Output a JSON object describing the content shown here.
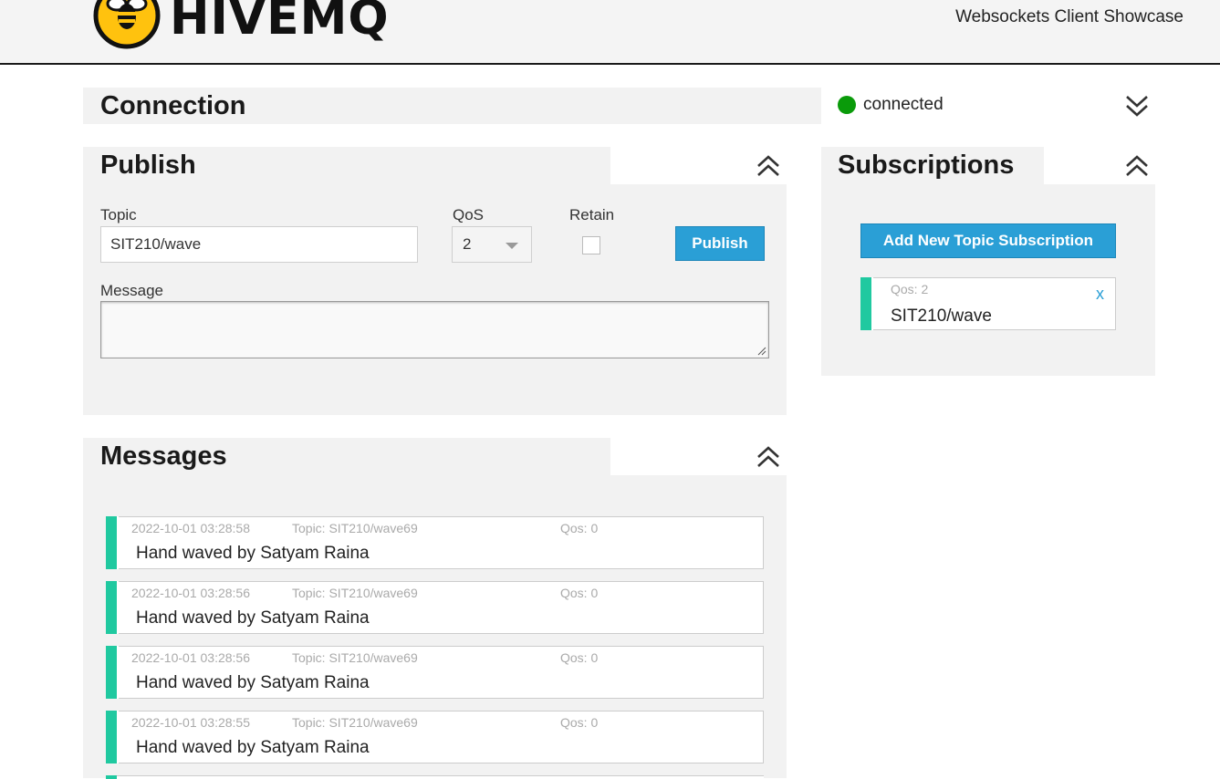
{
  "header": {
    "logo_text": "HIVEMQ",
    "subtitle": "Websockets Client Showcase"
  },
  "connection": {
    "title": "Connection",
    "status": "connected",
    "status_color": "#0a9b0a"
  },
  "publish": {
    "title": "Publish",
    "topic_label": "Topic",
    "topic_value": "SIT210/wave",
    "qos_label": "QoS",
    "qos_value": "2",
    "retain_label": "Retain",
    "retain_checked": false,
    "button_label": "Publish",
    "message_label": "Message",
    "message_value": ""
  },
  "subscriptions": {
    "title": "Subscriptions",
    "add_button_label": "Add New Topic Subscription",
    "items": [
      {
        "qos": "Qos: 2",
        "topic": "SIT210/wave",
        "remove_label": "x"
      }
    ]
  },
  "messages": {
    "title": "Messages",
    "items": [
      {
        "timestamp": "2022-10-01 03:28:58",
        "topic": "Topic: SIT210/wave69",
        "qos": "Qos: 0",
        "body": "Hand waved by Satyam Raina"
      },
      {
        "timestamp": "2022-10-01 03:28:56",
        "topic": "Topic: SIT210/wave69",
        "qos": "Qos: 0",
        "body": "Hand waved by Satyam Raina"
      },
      {
        "timestamp": "2022-10-01 03:28:56",
        "topic": "Topic: SIT210/wave69",
        "qos": "Qos: 0",
        "body": "Hand waved by Satyam Raina"
      },
      {
        "timestamp": "2022-10-01 03:28:55",
        "topic": "Topic: SIT210/wave69",
        "qos": "Qos: 0",
        "body": "Hand waved by Satyam Raina"
      }
    ]
  },
  "colors": {
    "accent": "#2a9fd6",
    "message_bar": "#20c9a0",
    "panel_bg": "#f2f2f2"
  },
  "icons": {
    "logo": "bee-logo-icon",
    "expand": "double-chevron-down-icon",
    "collapse": "double-chevron-up-icon"
  }
}
